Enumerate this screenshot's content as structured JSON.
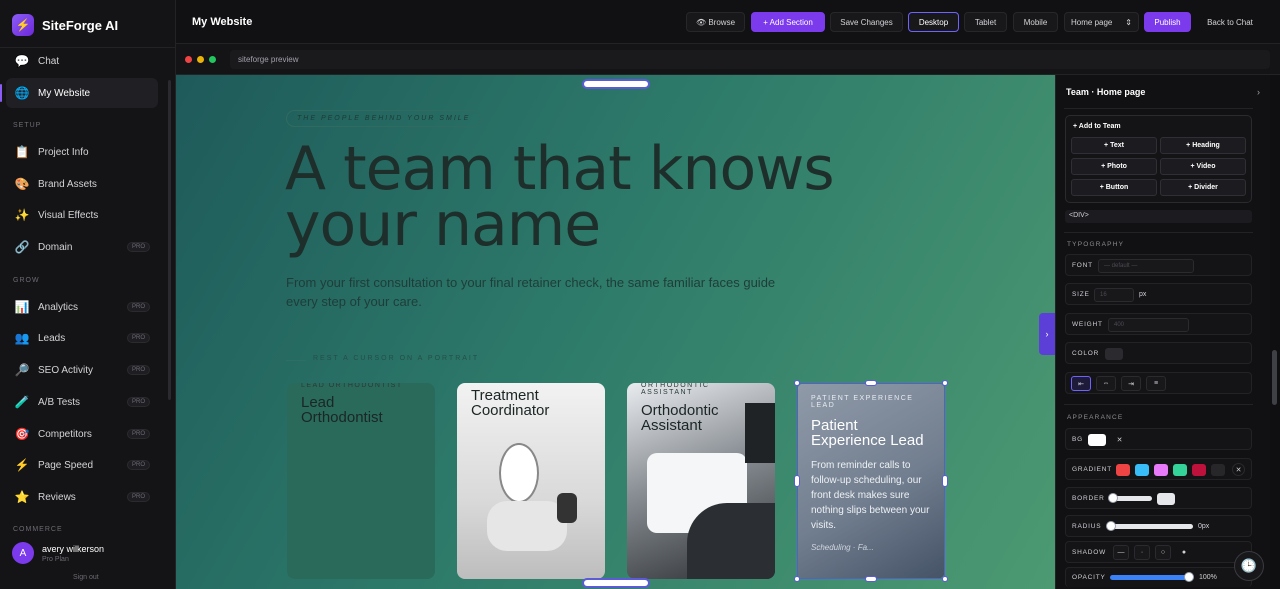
{
  "app": {
    "name": "SiteForge AI",
    "logo_icon": "⚡"
  },
  "sidebar": {
    "top_items": [
      {
        "label": "Chat",
        "icon": "💬"
      },
      {
        "label": "My Website",
        "icon": "🌐"
      }
    ],
    "setup_label": "SETUP",
    "setup_items": [
      {
        "label": "Project Info",
        "icon": "📋"
      },
      {
        "label": "Brand Assets",
        "icon": "🎨"
      },
      {
        "label": "Visual Effects",
        "icon": "✨"
      },
      {
        "label": "Domain",
        "icon": "🔗",
        "badge": "PRO"
      }
    ],
    "grow_label": "GROW",
    "grow_items": [
      {
        "label": "Analytics",
        "icon": "📊",
        "badge": "PRO"
      },
      {
        "label": "Leads",
        "icon": "👥",
        "badge": "PRO"
      },
      {
        "label": "SEO Activity",
        "icon": "🔎",
        "badge": "PRO"
      },
      {
        "label": "A/B Tests",
        "icon": "🧪",
        "badge": "PRO"
      },
      {
        "label": "Competitors",
        "icon": "🎯",
        "badge": "PRO"
      },
      {
        "label": "Page Speed",
        "icon": "⚡",
        "badge": "PRO"
      },
      {
        "label": "Reviews",
        "icon": "⭐",
        "badge": "PRO"
      }
    ],
    "commerce_label": "COMMERCE",
    "user": {
      "initial": "A",
      "name": "avery wilkerson",
      "plan": "Pro Plan",
      "sign_out": "Sign out"
    }
  },
  "topbar": {
    "title": "My Website",
    "browse": "👁 Browse",
    "add_section": "+ Add Section",
    "save": "Save Changes",
    "desktop": "Desktop",
    "tablet": "Tablet",
    "mobile": "Mobile",
    "page_select": "Home page",
    "publish": "Publish",
    "back": "Back to Chat"
  },
  "preview": {
    "url": "siteforge preview",
    "eyebrow": "THE PEOPLE BEHIND YOUR SMILE",
    "headline": "A team that knows your name",
    "subhead": "From your first consultation to your final retainer check, the same familiar faces guide every step of your care.",
    "hint": "REST A CURSOR ON A PORTRAIT",
    "cards": [
      {
        "role": "LEAD ORTHODONTIST",
        "name": "Lead Orthodontist"
      },
      {
        "role": "",
        "name": "Treatment Coordinator"
      },
      {
        "role": "ORTHODONTIC ASSISTANT",
        "name": "Orthodontic Assistant"
      },
      {
        "role": "PATIENT EXPERIENCE LEAD",
        "name": "Patient Experience Lead",
        "body": "From reminder calls to follow-up scheduling, our front desk makes sure nothing slips between your visits.",
        "foot": "Scheduling · Fa..."
      }
    ]
  },
  "inspector": {
    "title": "Team · Home page",
    "add_title": "+ Add to Team",
    "add_buttons": [
      "+ Text",
      "+ Heading",
      "+ Photo",
      "+ Video",
      "+ Button",
      "+ Divider"
    ],
    "element_tag": "<DIV>",
    "typography_label": "TYPOGRAPHY",
    "font_label": "FONT",
    "font_placeholder": "— default —",
    "size_label": "SIZE",
    "size_placeholder": "16",
    "size_unit": "px",
    "weight_label": "WEIGHT",
    "weight_placeholder": "400",
    "color_label": "COLOR",
    "align_buttons": [
      "⇤",
      "⇔",
      "⇥",
      "≡"
    ],
    "appearance_label": "APPEARANCE",
    "bg_label": "BG",
    "gradient_label": "GRADIENT",
    "gradient_swatches": [
      "#ef4444",
      "#38bdf8",
      "#e879f9",
      "#34d399",
      "#be123c",
      "#27272a"
    ],
    "border_label": "BORDER",
    "radius_label": "RADIUS",
    "radius_value": "0px",
    "shadow_label": "SHADOW",
    "shadow_buttons": [
      "—",
      "·",
      "○",
      "●"
    ],
    "opacity_label": "OPACITY",
    "opacity_value": "100%"
  },
  "colors": {
    "accent": "#7c3aed",
    "selection": "#5b5bd6"
  }
}
